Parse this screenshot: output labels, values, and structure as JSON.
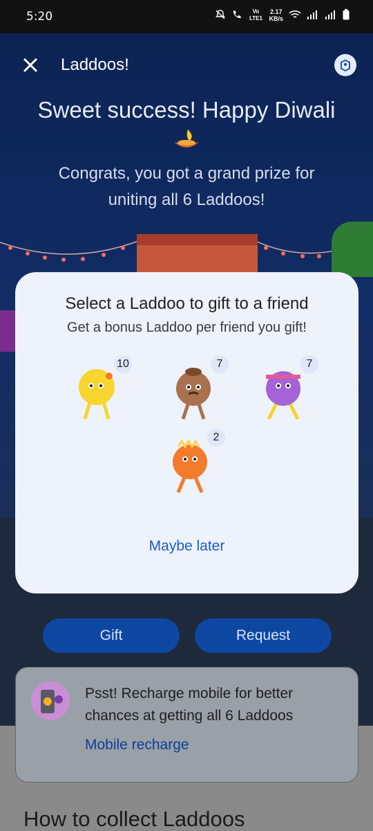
{
  "status_bar": {
    "time": "5:20",
    "network_speed": "2.17",
    "speed_unit": "KB/s",
    "volte": "Vo LTE1"
  },
  "header": {
    "title": "Laddoos!",
    "close_icon": "close-icon",
    "help_icon": "help-book-icon"
  },
  "headline": "Sweet success! Happy Diwali",
  "congrats": "Congrats, you got a grand prize for uniting all 6 Laddoos!",
  "dialog": {
    "title": "Select a Laddoo to gift to a friend",
    "subtitle": "Get a bonus Laddoo per friend you gift!",
    "laddoos": [
      {
        "count": "10",
        "color": "#f7d52e"
      },
      {
        "count": "7",
        "color": "#a9714e"
      },
      {
        "count": "7",
        "color": "#a463d6"
      },
      {
        "count": "2",
        "color": "#f37b2c"
      }
    ],
    "maybe_later": "Maybe later"
  },
  "buttons": {
    "gift": "Gift",
    "request": "Request"
  },
  "promo": {
    "text": "Psst! Recharge mobile for better chances at getting all 6 Laddoos",
    "link": "Mobile recharge"
  },
  "section_title": "How to collect Laddoos"
}
